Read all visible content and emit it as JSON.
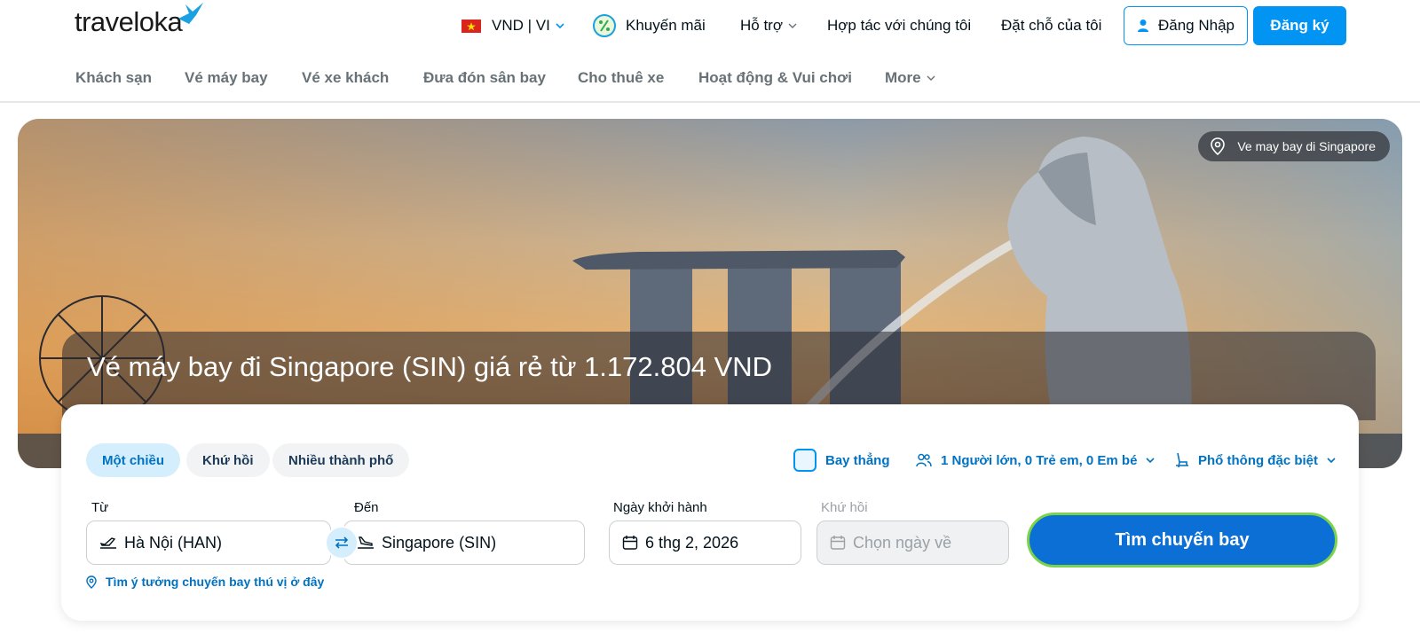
{
  "header": {
    "logo_text": "traveloka",
    "currency_lang": "VND | VI",
    "promotions": "Khuyến mãi",
    "support": "Hỗ trợ",
    "partner": "Hợp tác với chúng tôi",
    "my_bookings": "Đặt chỗ của tôi",
    "login": "Đăng Nhập",
    "signup": "Đăng ký",
    "colors": {
      "brand": "#0194f3",
      "text": "#03121a"
    }
  },
  "subnav": {
    "items": [
      "Khách sạn",
      "Vé máy bay",
      "Vé xe khách",
      "Đưa đón sân bay",
      "Cho thuê xe",
      "Hoạt động & Vui chơi",
      "More"
    ]
  },
  "hero": {
    "location_badge": "Ve may bay di Singapore",
    "title": "Vé máy bay đi Singapore (SIN) giá rẻ từ 1.172.804 VND"
  },
  "search": {
    "trip_types": [
      "Một chiều",
      "Khứ hồi",
      "Nhiều thành phố"
    ],
    "active_trip_type": "Một chiều",
    "direct_flight": "Bay thẳng",
    "passengers": "1 Người lớn, 0 Trẻ em, 0 Em bé",
    "cabin_class": "Phổ thông đặc biệt",
    "from_label": "Từ",
    "from_value": "Hà Nội (HAN)",
    "to_label": "Đến",
    "to_value": "Singapore (SIN)",
    "depart_label": "Ngày khởi hành",
    "depart_value": "6 thg 2, 2026",
    "return_label": "Khứ hồi",
    "return_placeholder": "Chọn ngày về",
    "search_button": "Tìm chuyến bay",
    "ideas_link": "Tìm ý tưởng chuyến bay thú vị ở đây"
  }
}
